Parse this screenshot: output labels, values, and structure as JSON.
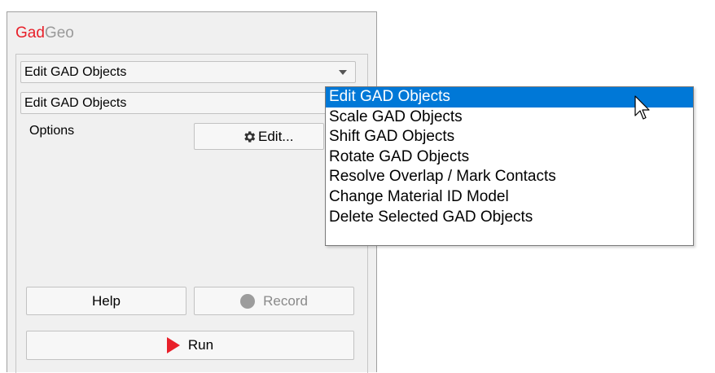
{
  "app": {
    "brand_gad": "Gad",
    "brand_geo": "Geo"
  },
  "panel": {
    "mode_select_value": "Edit GAD Objects",
    "operation_select_value": "Edit GAD Objects",
    "options_label": "Options",
    "edit_button_label": "Edit...",
    "help_button_label": "Help",
    "record_button_label": "Record",
    "run_button_label": "Run"
  },
  "dropdown": {
    "selected_index": 0,
    "options": [
      "Edit GAD Objects",
      "Scale GAD Objects",
      "Shift GAD Objects",
      "Rotate GAD Objects",
      "Resolve Overlap / Mark Contacts",
      "Change Material ID Model",
      "Delete Selected GAD Objects"
    ]
  },
  "colors": {
    "brand_red": "#e8202a",
    "brand_gray": "#9a9a9a",
    "selection_blue": "#0078d7",
    "panel_bg": "#f0f0f0"
  },
  "icons": {
    "edit_button": "gear-icon",
    "record_button": "record-dot-icon",
    "run_button": "play-icon",
    "combo_arrow": "chevron-down-icon",
    "cursor": "mouse-pointer-icon"
  }
}
